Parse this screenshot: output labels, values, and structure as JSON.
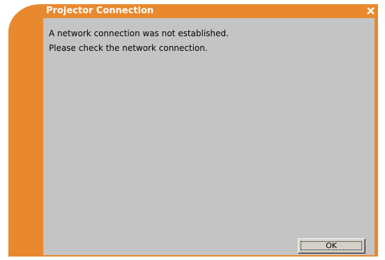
{
  "window": {
    "title": "Projector Connection",
    "close_icon": "close-icon",
    "close_symbol": "x"
  },
  "message": {
    "line1": "A network connection was not established.",
    "line2": "Please check the network connection."
  },
  "buttons": {
    "ok_label": "OK"
  },
  "colors": {
    "frame": "#e8892f",
    "content_bg": "#c4c4c4",
    "title_text": "#ffffff"
  }
}
